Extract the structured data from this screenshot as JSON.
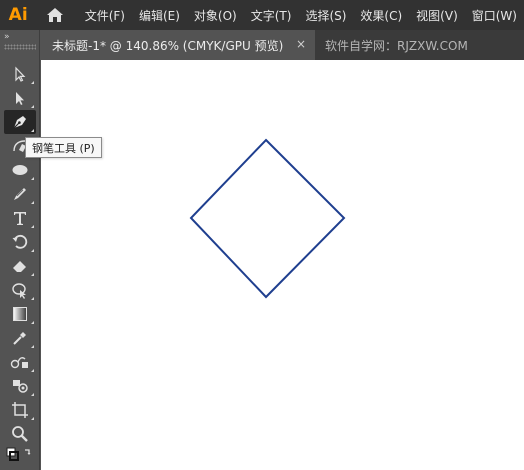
{
  "app": {
    "logo": "Ai"
  },
  "menubar": {
    "items": [
      "文件(F)",
      "编辑(E)",
      "对象(O)",
      "文字(T)",
      "选择(S)",
      "效果(C)",
      "视图(V)",
      "窗口(W)"
    ]
  },
  "tabs": {
    "active_title": "未标题-1* @ 140.86% (CMYK/GPU 预览)",
    "close_glyph": "×",
    "inactive_label": "软件自学网：RJZXW.COM"
  },
  "toolbar": {
    "collapse_glyph": "»",
    "tools": [
      {
        "name": "selection-tool",
        "icon": "selection-arrow-icon"
      },
      {
        "name": "direct-selection-tool",
        "icon": "direct-selection-arrow-icon"
      },
      {
        "name": "pen-tool",
        "icon": "pen-icon",
        "active": true
      },
      {
        "name": "curvature-tool",
        "icon": "curvature-icon"
      },
      {
        "name": "ellipse-tool",
        "icon": "ellipse-icon"
      },
      {
        "name": "paintbrush-tool",
        "icon": "paintbrush-icon"
      },
      {
        "name": "type-tool",
        "icon": "type-icon"
      },
      {
        "name": "rotate-tool",
        "icon": "rotate-icon"
      },
      {
        "name": "eraser-tool",
        "icon": "eraser-icon"
      },
      {
        "name": "shape-builder-tool",
        "icon": "shape-builder-icon"
      },
      {
        "name": "gradient-tool",
        "icon": "gradient-icon"
      },
      {
        "name": "eyedropper-tool",
        "icon": "eyedropper-icon"
      },
      {
        "name": "blend-tool",
        "icon": "blend-icon"
      },
      {
        "name": "symbol-sprayer-tool",
        "icon": "symbol-sprayer-icon"
      },
      {
        "name": "artboard-tool",
        "icon": "artboard-icon"
      },
      {
        "name": "zoom-tool",
        "icon": "zoom-icon"
      },
      {
        "name": "fill-stroke-swap",
        "icon": "fill-stroke-icon"
      }
    ]
  },
  "tooltip": {
    "text": "钢笔工具 (P)"
  },
  "canvas": {
    "shape": "diamond",
    "stroke_color": "#1f3f8f",
    "background": "#ffffff"
  },
  "colors": {
    "menubar_bg": "#323232",
    "panel_bg": "#535353",
    "logo_color": "#ff9a00"
  }
}
